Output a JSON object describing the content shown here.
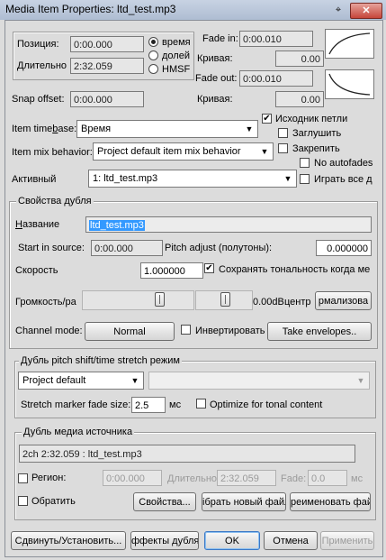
{
  "window": {
    "title": "Media Item Properties:  ltd_test.mp3",
    "close_glyph": "✕",
    "pin_glyph": "⌖"
  },
  "position": {
    "position_label": "Позиция:",
    "position_value": "0:00.000",
    "length_label": "Длительно",
    "length_value": "2:32.059",
    "radio_time": "время",
    "radio_beats": "долей",
    "radio_hmsf": "HMSF"
  },
  "fades": {
    "fade_in_label": "Fade in:",
    "fade_in_value": "0:00.010",
    "curve_label": "Кривая:",
    "curve_in_value": "0.00",
    "fade_out_label": "Fade out:",
    "fade_out_value": "0:00.010",
    "curve_out_label": "Кривая:",
    "curve_out_value": "0.00"
  },
  "snap": {
    "label": "Snap offset:",
    "value": "0:00.000"
  },
  "timebase": {
    "label": "Item timebase:",
    "value": "Время"
  },
  "mix": {
    "label": "Item mix behavior:",
    "value": "Project default item mix behavior"
  },
  "active": {
    "label": "Активный",
    "value": "1: ltd_test.mp3"
  },
  "options": {
    "loop_source": "Исходник петли",
    "mute": "Заглушить",
    "lock": "Закрепить",
    "no_autofades": "No autofades",
    "play_all_takes": "Играть все д"
  },
  "take": {
    "group_title": "Свойства дубля",
    "name_label": "Название",
    "name_value": "ltd_test.mp3",
    "start_label": "Start in source:",
    "start_value": "0:00.000",
    "pitch_label": "Pitch adjust (полутоны):",
    "pitch_value": "0.000000",
    "rate_label": "Скорость",
    "rate_value": "1.000000",
    "preserve_label": "Сохранять тональность когда ме",
    "volpan_label": "Громкость/ра",
    "volume_readout": "0.00dB",
    "pan_readout": "центр",
    "normalize_btn": "рмализова",
    "channel_label": "Channel mode:",
    "channel_value": "Normal",
    "invert_label": "Инвертировать",
    "envelopes_btn": "Take envelopes.."
  },
  "pitch": {
    "group_title": "Дубль pitch shift/time stretch режим",
    "mode_value": "Project default",
    "submode_value": "",
    "fade_label": "Stretch marker fade size:",
    "fade_value": "2.5",
    "fade_unit": "мс",
    "tonal_label": "Optimize for tonal content"
  },
  "source": {
    "group_title": "Дубль медиа источника",
    "file_value": "2ch 2:32.059 : ltd_test.mp3",
    "region_label": "Регион:",
    "region_start": "0:00.000",
    "region_len_label": "Длительно",
    "region_len": "2:32.059",
    "region_fade_label": "Fade:",
    "region_fade": "0.0",
    "region_fade_unit": "мс",
    "reverse_label": "Обратить",
    "props_btn": "Свойства...",
    "choose_btn": "ібрать новый файл",
    "rename_btn": "реименовать фай"
  },
  "footer": {
    "nudge_btn": "Сдвинуть/Установить...",
    "fx_btn": "ффекты дубля",
    "ok_btn": "OK",
    "cancel_btn": "Отмена",
    "apply_btn": "Применить"
  }
}
